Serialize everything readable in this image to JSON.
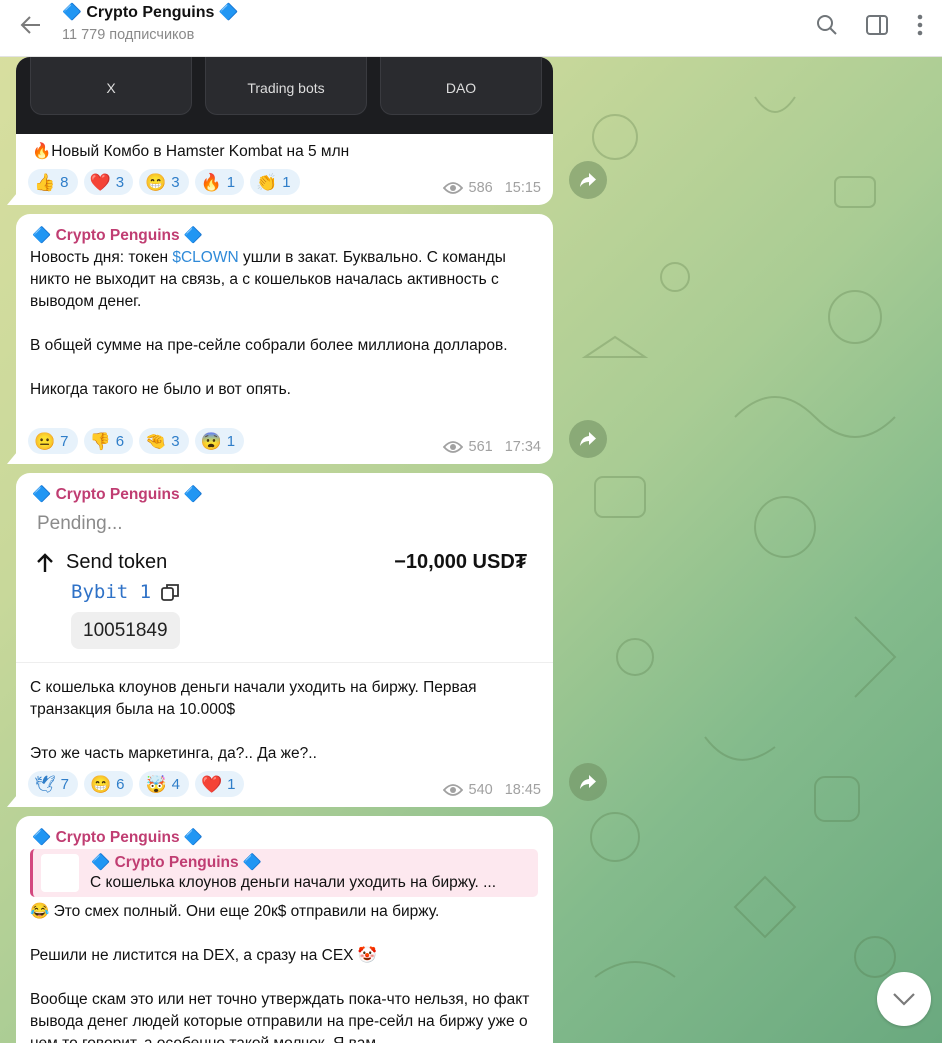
{
  "header": {
    "title": "🔷 Crypto Penguins 🔷",
    "subscribers": "11 779 подписчиков"
  },
  "messages": [
    {
      "tiles": [
        "X",
        "Trading bots",
        "DAO"
      ],
      "text": "🔥Новый Комбо в Hamster Kombat на 5 млн",
      "reactions": [
        {
          "emoji": "👍",
          "count": "8"
        },
        {
          "emoji": "❤️",
          "count": "3"
        },
        {
          "emoji": "😁",
          "count": "3"
        },
        {
          "emoji": "🔥",
          "count": "1"
        },
        {
          "emoji": "👏",
          "count": "1"
        }
      ],
      "views": "586",
      "time": "15:15"
    },
    {
      "sender": "🔷 Crypto Penguins 🔷",
      "text_before_link": "Новость дня: токен ",
      "link": "$CLOWN",
      "text_after_link": " ушли в закат. Буквально. С команды никто не выходит на связь, а с кошельков началась активность с выводом денег.\n\nВ общей сумме на пре-сейле собрали более миллиона долларов.\n\nНикогда такого не было и вот опять.",
      "reactions": [
        {
          "emoji": "😐",
          "count": "7"
        },
        {
          "emoji": "👎",
          "count": "6"
        },
        {
          "emoji": "🤏",
          "count": "3"
        },
        {
          "emoji": "😨",
          "count": "1"
        }
      ],
      "views": "561",
      "time": "17:34"
    },
    {
      "sender": "🔷 Crypto Penguins 🔷",
      "screenshot": {
        "status": "Pending...",
        "action": "Send token",
        "amount": "−10,000 USD₮",
        "account": "Bybit 1",
        "code": "10051849"
      },
      "text": "С кошелька клоунов деньги начали уходить на биржу. Первая транзакция была на 10.000$\n\nЭто же часть маркетинга, да?.. Да же?..",
      "reactions": [
        {
          "emoji": "🕊",
          "count": "7"
        },
        {
          "emoji": "😁",
          "count": "6"
        },
        {
          "emoji": "🤯",
          "count": "4"
        },
        {
          "emoji": "❤️",
          "count": "1"
        }
      ],
      "views": "540",
      "time": "18:45"
    },
    {
      "sender": "🔷 Crypto Penguins 🔷",
      "quote_sender": "🔷 Crypto Penguins 🔷",
      "quote_text": "С кошелька клоунов деньги начали уходить на биржу. ...",
      "text": "😂 Это смех полный. Они еще 20к$ отправили на биржу.\n\nРешили не листится на DEX, а сразу на CEX 🤡\n\nВообще скам это или нет точно утверждать пока-что нельзя, но факт вывода денег людей которые отправили на пре-сейл на биржу уже о нем то говорит, а особенно такой молчок. Я вам"
    }
  ]
}
